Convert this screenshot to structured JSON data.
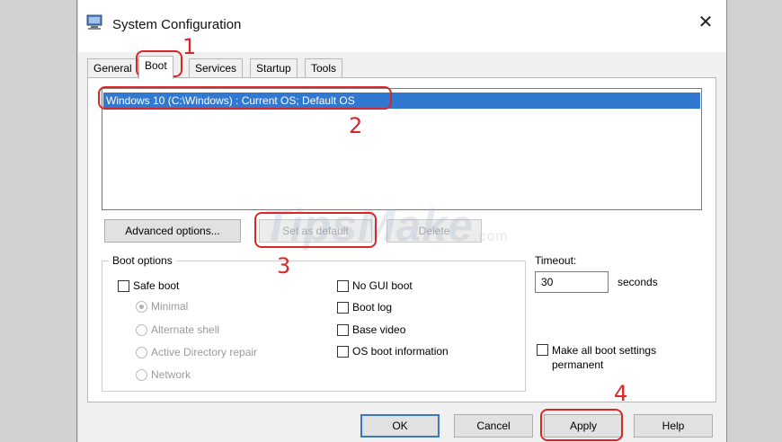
{
  "window": {
    "title": "System Configuration",
    "close_glyph": "✕"
  },
  "tabs": [
    {
      "label": "General"
    },
    {
      "label": "Boot"
    },
    {
      "label": "Services"
    },
    {
      "label": "Startup"
    },
    {
      "label": "Tools"
    }
  ],
  "os_list": {
    "items": [
      "Windows 10 (C:\\Windows) : Current OS; Default OS"
    ]
  },
  "buttons": {
    "advanced": "Advanced options...",
    "set_default": "Set as default",
    "delete": "Delete",
    "ok": "OK",
    "cancel": "Cancel",
    "apply": "Apply",
    "help": "Help"
  },
  "boot_options": {
    "title": "Boot options",
    "safe_boot": "Safe boot",
    "radios": [
      "Minimal",
      "Alternate shell",
      "Active Directory repair",
      "Network"
    ],
    "right": [
      "No GUI boot",
      "Boot log",
      "Base video",
      "OS boot information"
    ]
  },
  "timeout": {
    "label": "Timeout:",
    "value": "30",
    "unit": "seconds"
  },
  "make_permanent": {
    "line1": "Make all boot settings",
    "line2": "permanent"
  },
  "annotations": [
    "1",
    "2",
    "3",
    "4"
  ],
  "watermark": {
    "text": "TipsMake",
    "suffix": ".com"
  },
  "colors": {
    "selection": "#3178d1",
    "annotation": "#d9262b",
    "default_button_border": "#3a78c6"
  },
  "icons": {
    "app": "system-configuration-icon",
    "close": "close-icon"
  }
}
